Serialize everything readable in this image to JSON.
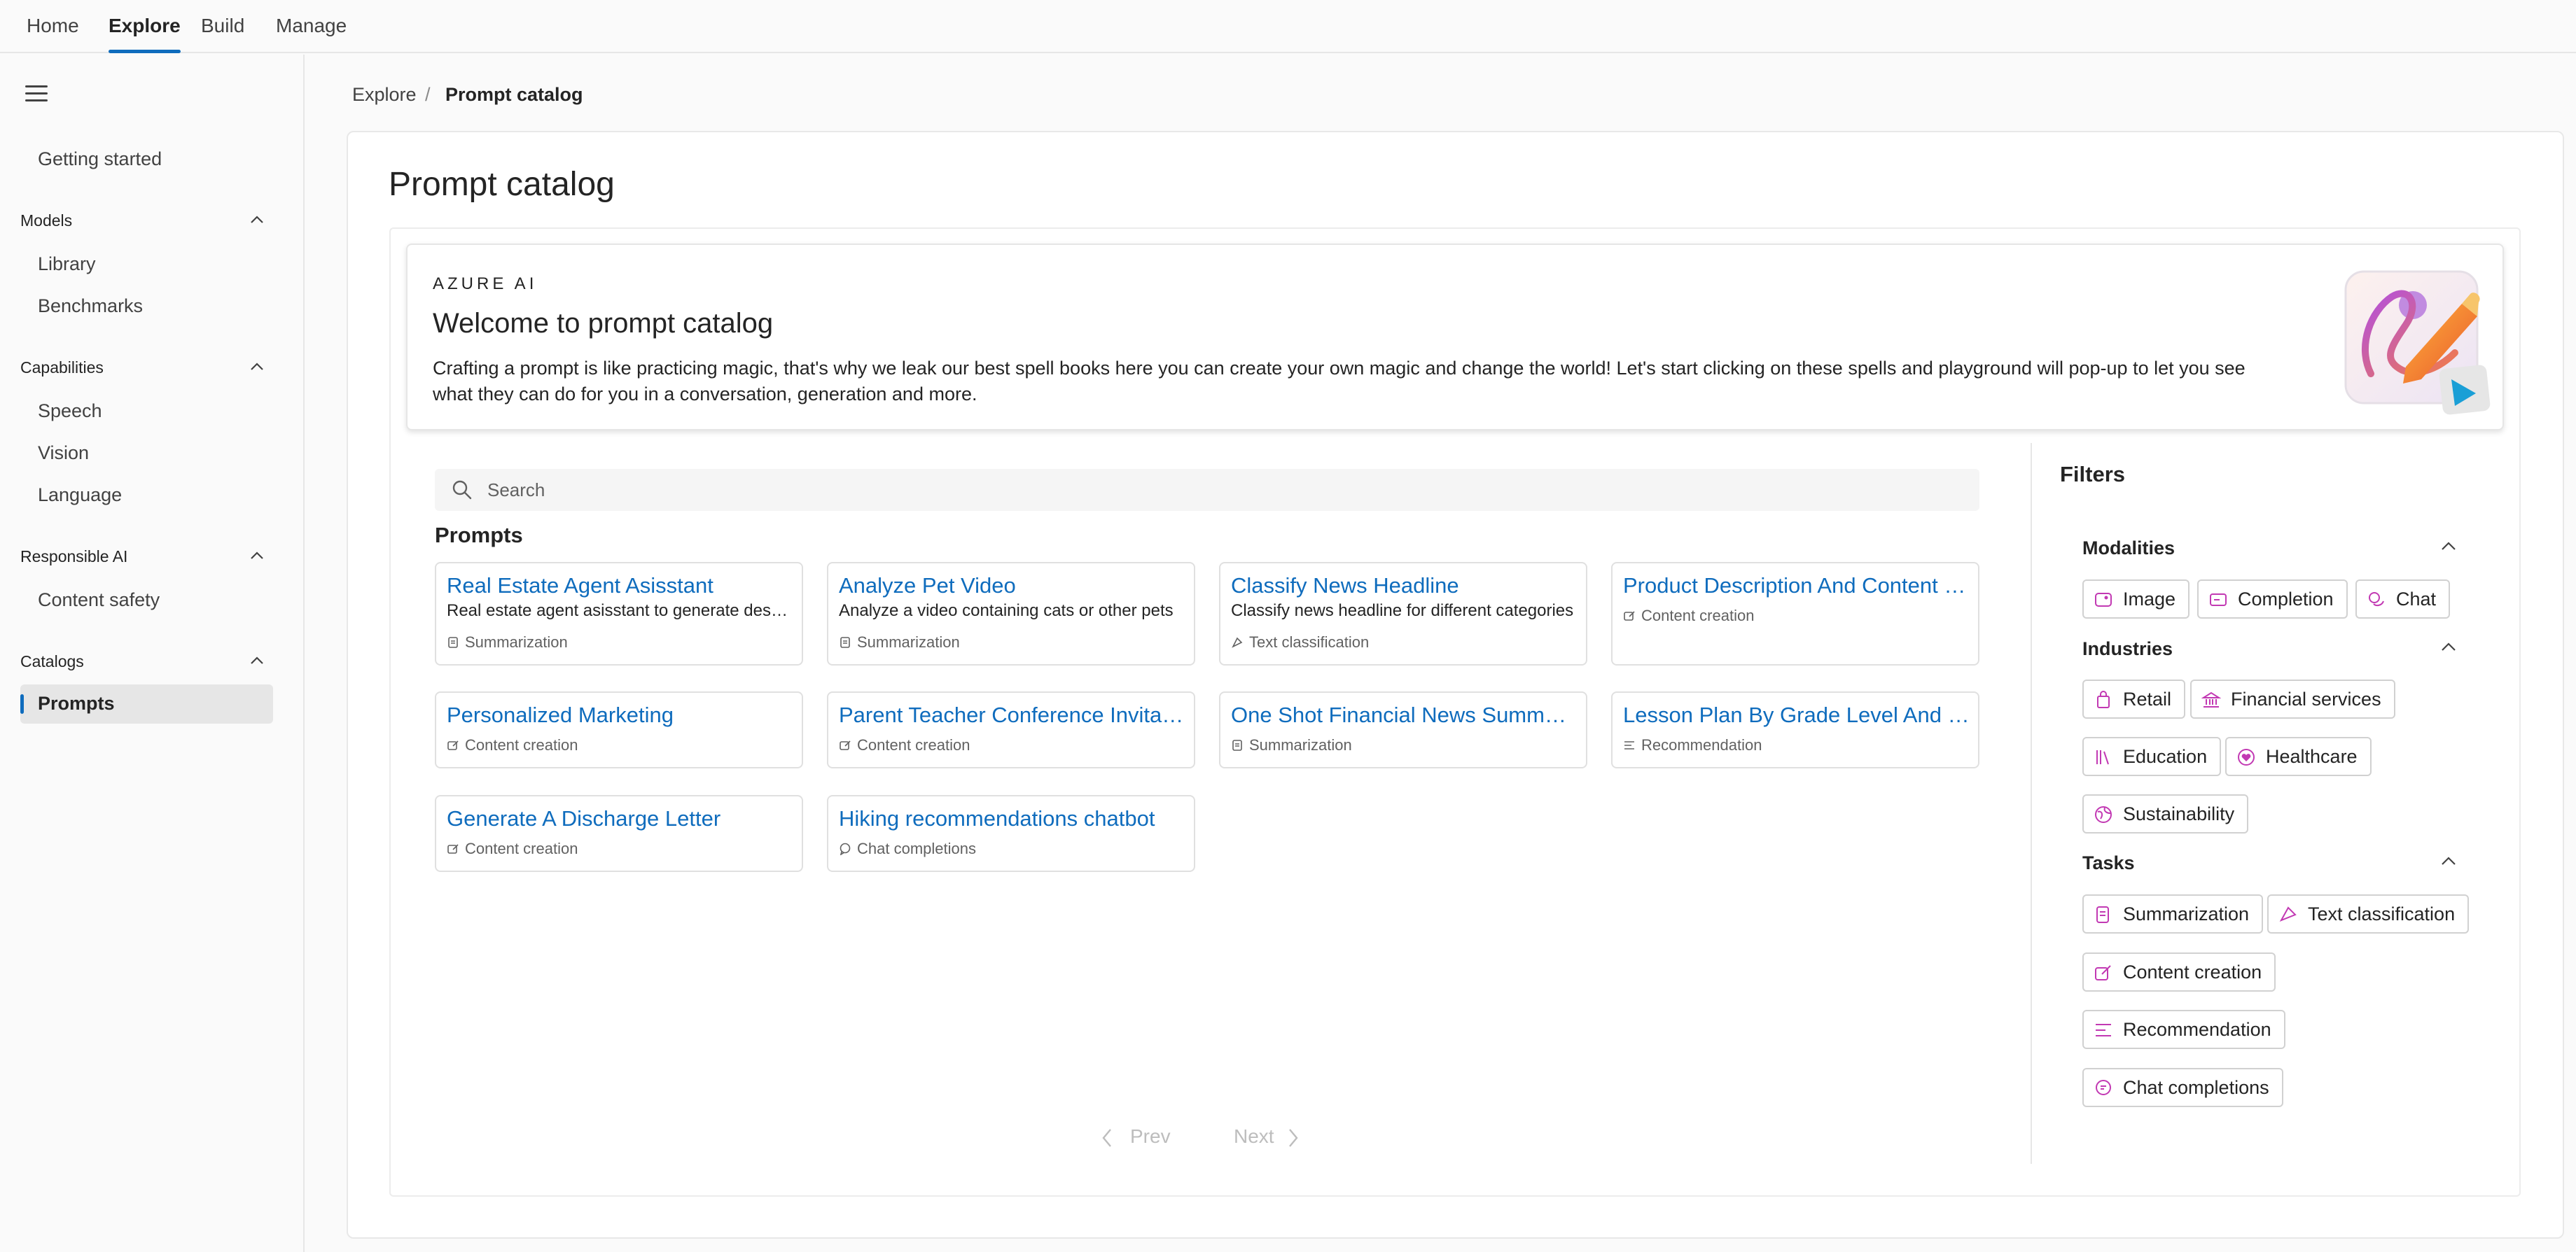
{
  "topnav": {
    "tabs": [
      "Home",
      "Explore",
      "Build",
      "Manage"
    ],
    "active": "Explore",
    "accent": "#0f6cbd"
  },
  "sidebar": {
    "getting_started": "Getting started",
    "sections": [
      {
        "title": "Models",
        "items": [
          "Library",
          "Benchmarks"
        ]
      },
      {
        "title": "Capabilities",
        "items": [
          "Speech",
          "Vision",
          "Language"
        ]
      },
      {
        "title": "Responsible AI",
        "items": [
          "Content safety"
        ]
      },
      {
        "title": "Catalogs",
        "items": [
          "Prompts"
        ]
      }
    ],
    "selected": "Prompts"
  },
  "breadcrumb": {
    "parent": "Explore",
    "separator": "/",
    "current": "Prompt catalog"
  },
  "page": {
    "title": "Prompt catalog"
  },
  "banner": {
    "eyebrow": "AZURE AI",
    "title": "Welcome to prompt catalog",
    "description": "Crafting a prompt is like practicing magic, that's why we leak our best spell books here you can create your own magic and change the world! Let's start clicking on these spells and playground will pop-up to let you see what they can do for you in a conversation, generation and more."
  },
  "search": {
    "placeholder": "Search",
    "value": ""
  },
  "prompts": {
    "title": "Prompts",
    "items": [
      {
        "title": "Real Estate Agent Asisstant",
        "description": "Real estate agent asisstant to generate descriptions",
        "tag": "Summarization",
        "tag_icon": "summarization-icon"
      },
      {
        "title": "Analyze Pet Video",
        "description": "Analyze a video containing cats or other pets",
        "tag": "Summarization",
        "tag_icon": "summarization-icon"
      },
      {
        "title": "Classify News Headline",
        "description": "Classify news headline for different categories",
        "tag": "Text classification",
        "tag_icon": "text-classification-icon"
      },
      {
        "title": "Product Description And Content Generation",
        "description": "",
        "tag": "Content creation",
        "tag_icon": "content-creation-icon"
      },
      {
        "title": "Personalized Marketing",
        "description": "",
        "tag": "Content creation",
        "tag_icon": "content-creation-icon"
      },
      {
        "title": "Parent Teacher Conference Invitation",
        "description": "",
        "tag": "Content creation",
        "tag_icon": "content-creation-icon"
      },
      {
        "title": "One Shot Financial News Summarization",
        "description": "",
        "tag": "Summarization",
        "tag_icon": "summarization-icon"
      },
      {
        "title": "Lesson Plan By Grade Level And Subject",
        "description": "",
        "tag": "Recommendation",
        "tag_icon": "recommendation-icon"
      },
      {
        "title": "Generate A Discharge Letter",
        "description": "",
        "tag": "Content creation",
        "tag_icon": "content-creation-icon"
      },
      {
        "title": "Hiking recommendations chatbot",
        "description": "",
        "tag": "Chat completions",
        "tag_icon": "chat-completions-icon"
      }
    ]
  },
  "pagination": {
    "prev": "Prev",
    "next": "Next"
  },
  "filters": {
    "title": "Filters",
    "groups": [
      {
        "title": "Modalities",
        "chips": [
          {
            "label": "Image",
            "icon": "image-icon"
          },
          {
            "label": "Completion",
            "icon": "completion-icon"
          },
          {
            "label": "Chat",
            "icon": "chat-icon"
          }
        ]
      },
      {
        "title": "Industries",
        "chips": [
          {
            "label": "Retail",
            "icon": "shopping-bag-icon"
          },
          {
            "label": "Financial services",
            "icon": "bank-icon"
          },
          {
            "label": "Education",
            "icon": "books-icon"
          },
          {
            "label": "Healthcare",
            "icon": "heart-icon"
          },
          {
            "label": "Sustainability",
            "icon": "globe-icon"
          }
        ]
      },
      {
        "title": "Tasks",
        "chips": [
          {
            "label": "Summarization",
            "icon": "summarization-icon"
          },
          {
            "label": "Text classification",
            "icon": "text-classification-icon"
          },
          {
            "label": "Content creation",
            "icon": "content-creation-icon"
          },
          {
            "label": "Recommendation",
            "icon": "recommendation-icon"
          },
          {
            "label": "Chat completions",
            "icon": "chat-completions-icon"
          }
        ]
      }
    ],
    "icon_color": "#c239b3"
  }
}
